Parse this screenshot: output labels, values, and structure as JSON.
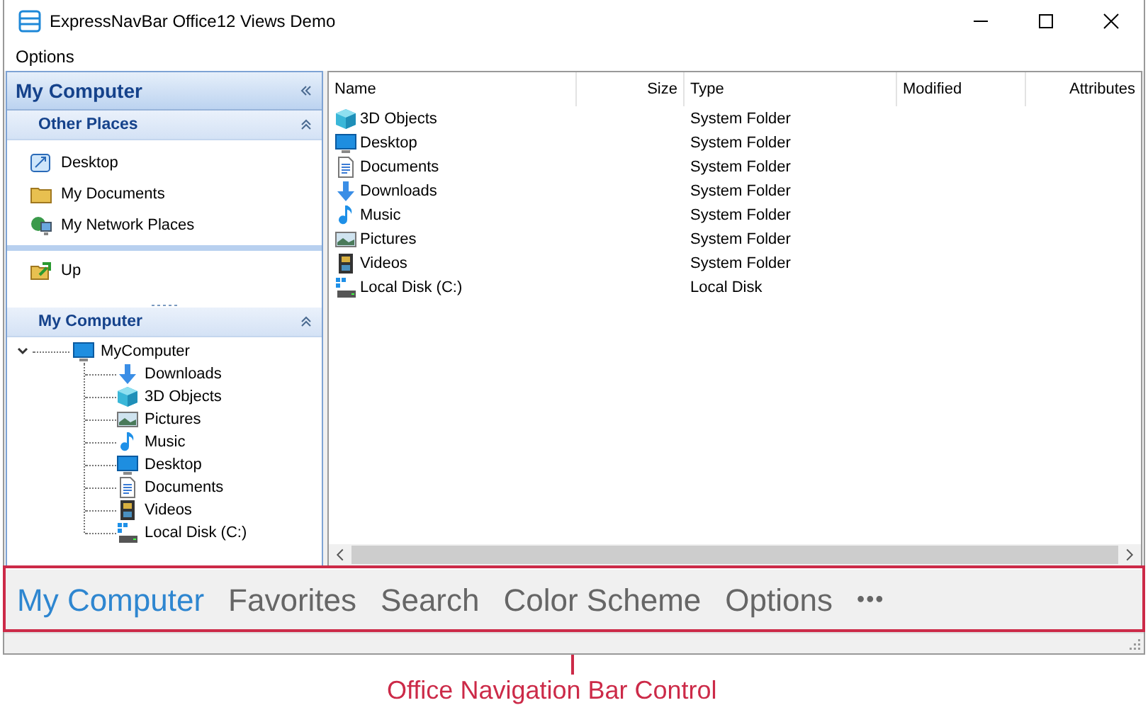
{
  "window": {
    "title": "ExpressNavBar Office12 Views Demo"
  },
  "menu": [
    "Options"
  ],
  "nav_pane": {
    "title": "My Computer",
    "groups": [
      {
        "title": "Other Places",
        "expanded": true,
        "items": [
          {
            "label": "Desktop",
            "kind": "desktop-shortcut"
          },
          {
            "label": "My Documents",
            "kind": "folder"
          },
          {
            "label": "My Network Places",
            "kind": "network"
          }
        ],
        "links": [
          {
            "label": "Up",
            "kind": "up"
          }
        ]
      },
      {
        "title": "My Computer",
        "expanded": true,
        "tree": [
          {
            "label": "MyComputer",
            "kind": "monitor",
            "expanded": true,
            "children": [
              {
                "label": "Downloads",
                "kind": "download"
              },
              {
                "label": "3D Objects",
                "kind": "cube"
              },
              {
                "label": "Pictures",
                "kind": "picture"
              },
              {
                "label": "Music",
                "kind": "music"
              },
              {
                "label": "Desktop",
                "kind": "monitor"
              },
              {
                "label": "Documents",
                "kind": "document"
              },
              {
                "label": "Videos",
                "kind": "video"
              },
              {
                "label": "Local Disk (C:)",
                "kind": "disk"
              }
            ]
          }
        ]
      }
    ]
  },
  "table": {
    "columns": [
      "Name",
      "Size",
      "Type",
      "Modified",
      "Attributes"
    ],
    "rows": [
      {
        "name": "3D Objects",
        "kind": "cube",
        "type": "System Folder"
      },
      {
        "name": "Desktop",
        "kind": "monitor",
        "type": "System Folder"
      },
      {
        "name": "Documents",
        "kind": "document",
        "type": "System Folder"
      },
      {
        "name": "Downloads",
        "kind": "download",
        "type": "System Folder"
      },
      {
        "name": "Music",
        "kind": "music",
        "type": "System Folder"
      },
      {
        "name": "Pictures",
        "kind": "picture",
        "type": "System Folder"
      },
      {
        "name": "Videos",
        "kind": "video",
        "type": "System Folder"
      },
      {
        "name": "Local Disk (C:)",
        "kind": "disk",
        "type": "Local Disk"
      }
    ]
  },
  "navigation_bar": {
    "items": [
      {
        "label": "My Computer",
        "selected": true
      },
      {
        "label": "Favorites",
        "selected": false
      },
      {
        "label": "Search",
        "selected": false
      },
      {
        "label": "Color Scheme",
        "selected": false
      },
      {
        "label": "Options",
        "selected": false
      }
    ],
    "more": "•••"
  },
  "annotation": {
    "label": "Office Navigation Bar Control"
  }
}
